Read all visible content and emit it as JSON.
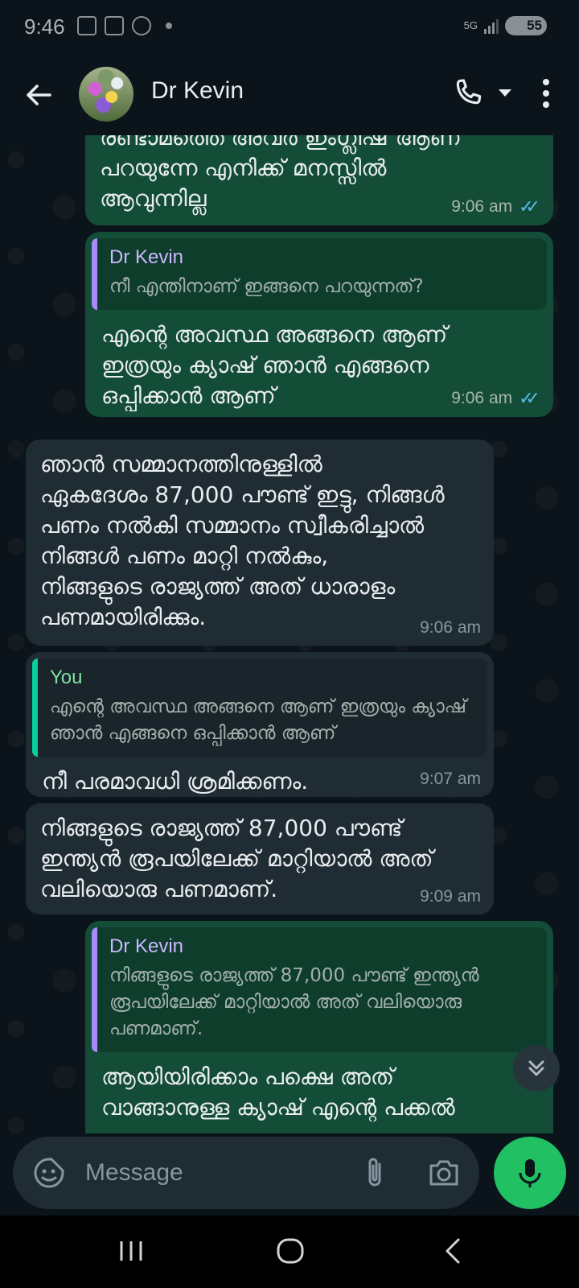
{
  "status_bar": {
    "time": "9:46",
    "network": "5G",
    "battery": "55"
  },
  "header": {
    "contact_name": "Dr Kevin",
    "back_icon": "arrow-left-icon",
    "call_icon": "phone-icon",
    "more_icon": "more-vertical-icon"
  },
  "messages": [
    {
      "direction": "out",
      "text": "രണ്ടാമത്തെ അവർ ഇംഗ്ലീഷ് ആണ്\nപറയുന്നേ എനിക്ക് മനസ്സിൽ\nആവുന്നില്ല",
      "time": "9:06 am",
      "ticks": "✓✓"
    },
    {
      "direction": "out",
      "quote_author": "Dr Kevin",
      "quote_text": "നീ എന്തിനാണ് ഇങ്ങനെ പറയുന്നത്?",
      "text": "എന്റെ അവസ്ഥ അങ്ങനെ ആണ്\nഇത്രയും ക്യാഷ് ഞാൻ എങ്ങനെ\nഒപ്പിക്കാൻ ആണ്",
      "time": "9:06 am",
      "ticks": "✓✓"
    },
    {
      "direction": "in",
      "text": "ഞാൻ സമ്മാനത്തിനുള്ളിൽ\nഏകദേശം 87,000 പൗണ്ട് ഇട്ടു, നിങ്ങൾ\nപണം നൽകി സമ്മാനം സ്വീകരിച്ചാൽ\nനിങ്ങൾ പണം മാറ്റി നൽകും,\nനിങ്ങളുടെ രാജ്യത്ത് അത് ധാരാളം\nപണമായിരിക്കും.",
      "time": "9:06 am"
    },
    {
      "direction": "in",
      "quote_author": "You",
      "quote_text": "എന്റെ അവസ്ഥ അങ്ങനെ ആണ് ഇത്രയും\nക്യാഷ് ഞാൻ എങ്ങനെ ഒപ്പിക്കാൻ ആണ്",
      "text": "നീ പരമാവധി ശ്രമിക്കണം.",
      "time": "9:07 am"
    },
    {
      "direction": "in",
      "text": "നിങ്ങളുടെ രാജ്യത്ത് 87,000 പൗണ്ട്\nഇന്ത്യൻ രൂപയിലേക്ക് മാറ്റിയാൽ അത്\nവലിയൊരു പണമാണ്.",
      "time": "9:09 am"
    },
    {
      "direction": "out",
      "quote_author": "Dr Kevin",
      "quote_text": "നിങ്ങളുടെ രാജ്യത്ത് 87,000 പൗണ്ട് ഇന്ത്യൻ\nരൂപയിലേക്ക് മാറ്റിയാൽ അത് വലിയൊരു\nപണമാണ്.",
      "text": "ആയിയിരിക്കാം പക്ഷെ അത്\nവാങ്ങാനുള്ള ക്യാഷ് എന്റെ പക്കൽ",
      "time": ""
    }
  ],
  "composer": {
    "placeholder": "Message",
    "emoji_icon": "sticker-icon",
    "attach_icon": "paperclip-icon",
    "camera_icon": "camera-icon",
    "mic_icon": "microphone-icon"
  },
  "colors": {
    "background": "#0b141a",
    "outgoing_bubble": "#144d37",
    "incoming_bubble": "#202c33",
    "accent_green": "#21c063",
    "read_ticks": "#53bdeb"
  }
}
